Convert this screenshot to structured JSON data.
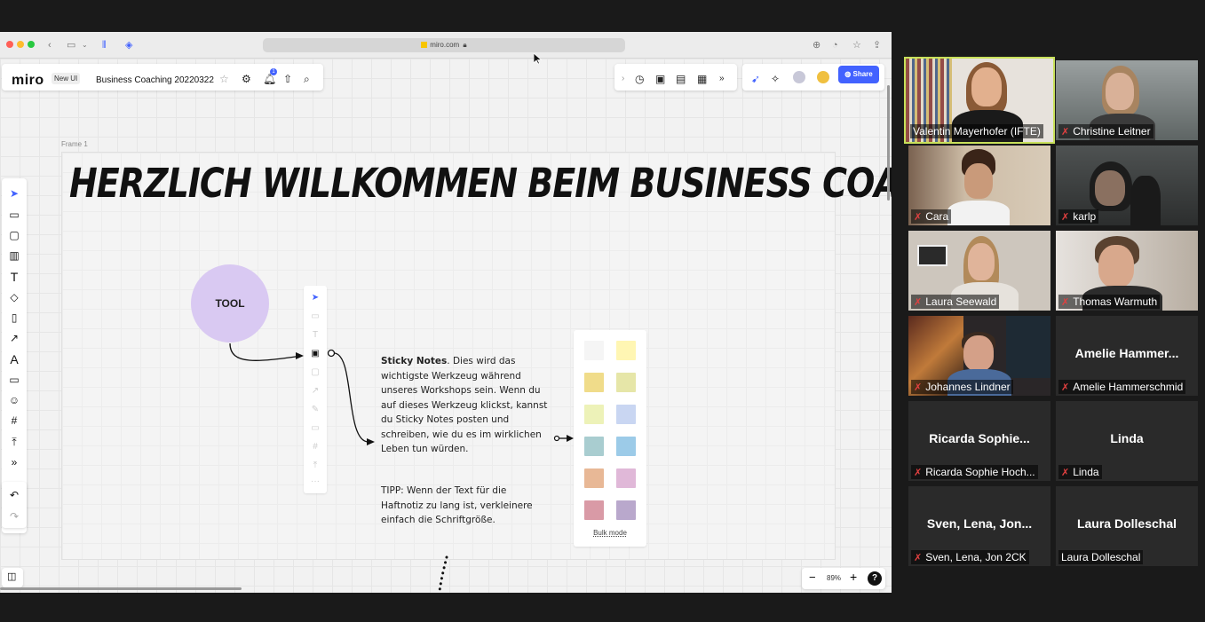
{
  "browser": {
    "url": "miro.com",
    "colors": {
      "close": "#ff5f57",
      "minimize": "#febc2e",
      "maximize": "#28c840"
    }
  },
  "miro": {
    "logo": "miro",
    "new_ui_badge": "New UI",
    "board_title": "Business Coaching 20220322",
    "notification_count": "1",
    "share_label": "Share",
    "frame_label": "Frame 1",
    "headline": "HERZLICH WILLKOMMEN BEIM BUSINESS COACHING!",
    "tool_label": "TOOL",
    "sticky_title": "Sticky Notes",
    "sticky_body": ".  Dies wird das wichtigste Werkzeug während unseres Workshops sein. Wenn du auf dieses Werkzeug klickst, kannst du Sticky Notes posten und schreiben, wie du es im wirklichen Leben tun würden.",
    "tipp": "TIPP: Wenn der Text für die Haftnotiz zu lang ist, verkleinere einfach die Schriftgröße.",
    "bulk_mode": "Bulk mode",
    "zoom_level": "89%",
    "accent_color": "#4262ff",
    "sticky_colors": [
      "#f5f5f5",
      "#fff6b3",
      "#f0dc8a",
      "#e6e6a8",
      "#edf2b8",
      "#c9d6f2",
      "#a9cdd0",
      "#9ccbe8",
      "#e8b896",
      "#e0b8d8",
      "#d99aa6",
      "#b9a8cc"
    ]
  },
  "participants": [
    {
      "name": "Valentin Mayerhofer (IFTE)",
      "muted": false,
      "active": true
    },
    {
      "name": "Christine Leitner",
      "muted": true
    },
    {
      "name": "Cara",
      "muted": true
    },
    {
      "name": "karlp",
      "muted": true
    },
    {
      "name": "Laura Seewald",
      "muted": true
    },
    {
      "name": "Thomas Warmuth",
      "muted": true
    },
    {
      "name": "Johannes Lindner",
      "muted": true
    },
    {
      "name": "Amelie Hammerschmid",
      "display": "Amelie  Hammer...",
      "muted": true
    },
    {
      "name": "Ricarda Sophie Hoch...",
      "display": "Ricarda  Sophie...",
      "muted": true
    },
    {
      "name": "Linda",
      "display": "Linda",
      "muted": true
    },
    {
      "name": "Sven, Lena, Jon 2CK",
      "display": "Sven,  Lena,  Jon...",
      "muted": true
    },
    {
      "name": "Laura Dolleschal",
      "display": "Laura Dolleschal",
      "muted": false
    }
  ]
}
